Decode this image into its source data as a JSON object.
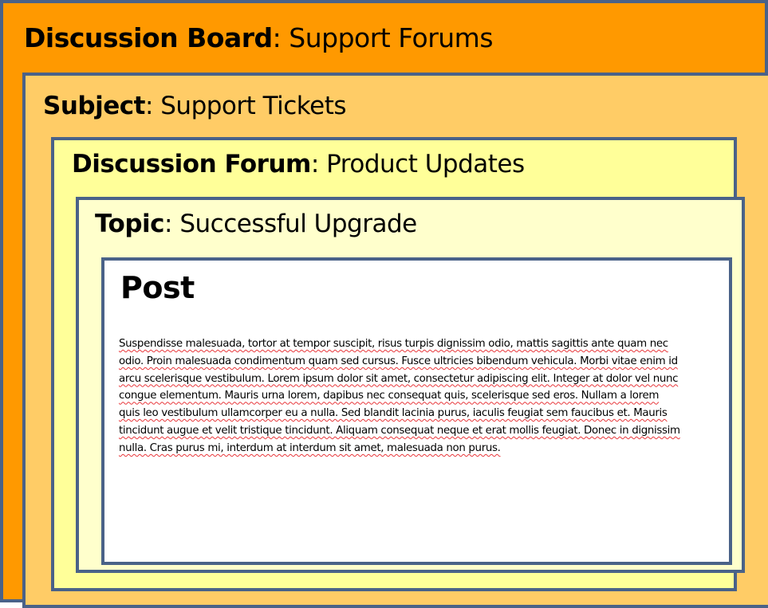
{
  "board": {
    "label": "Discussion Board",
    "separator": ":",
    "value": "Support Forums"
  },
  "subject": {
    "label": "Subject",
    "separator": ":",
    "value": "Support Tickets"
  },
  "forum": {
    "label": "Discussion Forum",
    "separator": ":",
    "value": "Product Updates"
  },
  "topic": {
    "label": "Topic",
    "separator": ":",
    "value": "Successful Upgrade"
  },
  "post": {
    "title": "Post",
    "body": "Suspendisse malesuada, tortor at tempor suscipit, risus turpis dignissim odio, mattis sagittis ante quam nec odio. Proin malesuada condimentum quam sed cursus. Fusce ultricies bibendum vehicula. Morbi vitae enim id arcu scelerisque vestibulum. Lorem ipsum dolor sit amet, consectetur adipiscing elit. Integer at dolor vel nunc congue elementum. Mauris urna lorem, dapibus nec consequat quis, scelerisque sed eros. Nullam a lorem quis leo vestibulum ullamcorper eu a nulla. Sed blandit lacinia purus, iaculis feugiat sem faucibus et. Mauris tincidunt augue et velit tristique tincidunt. Aliquam consequat neque et erat mollis feugiat. Donec in dignissim nulla. Cras purus mi, interdum at interdum sit amet, malesuada non purus."
  },
  "colors": {
    "board": "#ff9900",
    "subject": "#ffcc66",
    "forum": "#ffff99",
    "topic": "#ffffcc",
    "post": "#ffffff",
    "border": "#4a6288",
    "spellcheck_underline": "#e8363a"
  }
}
